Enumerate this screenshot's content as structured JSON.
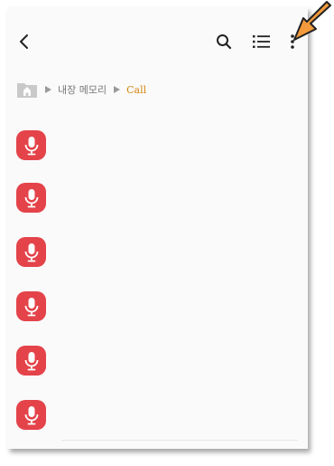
{
  "breadcrumb": {
    "segments": [
      "내장 메모리",
      "Call"
    ]
  },
  "icons": {
    "back": "chevron-left-icon",
    "search": "search-icon",
    "list_view": "list-view-icon",
    "more": "more-vert-icon",
    "home": "home-folder-icon",
    "mic": "mic-icon",
    "annotation_arrow": "orange-arrow-icon"
  },
  "colors": {
    "mic_tile": "#e4434a",
    "breadcrumb_current": "#d3860f",
    "arrow": "#f39a3c"
  },
  "recordings": [
    {
      "icon": "mic-icon"
    },
    {
      "icon": "mic-icon"
    },
    {
      "icon": "mic-icon"
    },
    {
      "icon": "mic-icon"
    },
    {
      "icon": "mic-icon"
    },
    {
      "icon": "mic-icon"
    }
  ]
}
